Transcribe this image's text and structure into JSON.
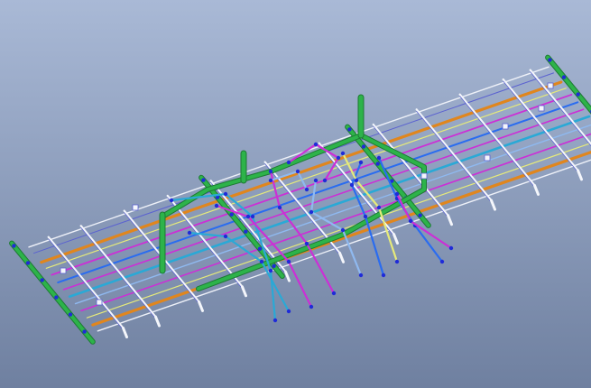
{
  "viewport": {
    "background_top": "#a9b9d6",
    "background_bottom": "#6f80a0"
  },
  "colors": {
    "frame_white": "#eef1f8",
    "frame_edge": "#5b62d0",
    "steel_green": "#2db34a",
    "steel_green_dark": "#1d7a33",
    "pipe_orange": "#e0861e",
    "pipe_magenta": "#cc2fd6",
    "pipe_blue": "#2a6cf0",
    "pipe_cyan": "#2aa9d6",
    "pipe_yellow": "#e6ea7a",
    "pipe_lightblue": "#8fb9f0",
    "node_blue": "#1f2bd8",
    "support_white": "#f4f6fb"
  },
  "icons": {
    "view_cube": "none"
  }
}
